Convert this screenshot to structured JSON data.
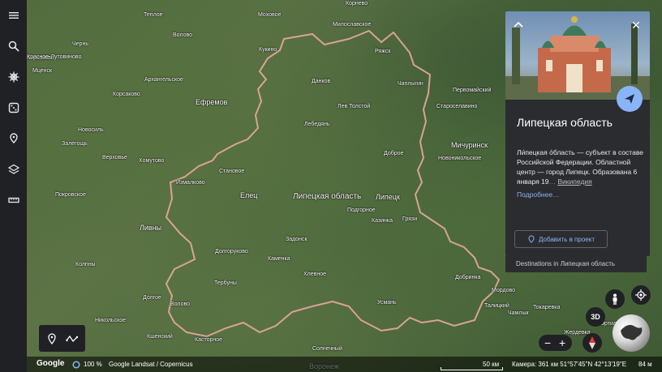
{
  "region_name": "Липецкая область",
  "map_labels": [
    {
      "text": "Корнево",
      "cls": ""
    },
    {
      "text": "Корсакова",
      "cls": ""
    },
    {
      "text": "Теплое",
      "cls": ""
    },
    {
      "text": "Моховое",
      "cls": ""
    },
    {
      "text": "Волово",
      "cls": ""
    },
    {
      "text": "Милославское",
      "cls": ""
    },
    {
      "text": "Чернь",
      "cls": ""
    },
    {
      "text": "Кукино",
      "cls": ""
    },
    {
      "text": "Ряжск",
      "cls": ""
    },
    {
      "text": "Красное-Лутовиново",
      "cls": ""
    },
    {
      "text": "Мценск",
      "cls": ""
    },
    {
      "text": "Архангельское",
      "cls": ""
    },
    {
      "text": "Данков",
      "cls": ""
    },
    {
      "text": "Чаплыгин",
      "cls": ""
    },
    {
      "text": "Первомайский",
      "cls": ""
    },
    {
      "text": "Корсаково",
      "cls": ""
    },
    {
      "text": "Ефремов",
      "cls": "big"
    },
    {
      "text": "Лев Толстой",
      "cls": ""
    },
    {
      "text": "Староселавино",
      "cls": ""
    },
    {
      "text": "Лебедянь",
      "cls": ""
    },
    {
      "text": "Мичуринск",
      "cls": "big"
    },
    {
      "text": "Новосиль",
      "cls": ""
    },
    {
      "text": "Залегощь",
      "cls": ""
    },
    {
      "text": "Доброе",
      "cls": ""
    },
    {
      "text": "Новоникольское",
      "cls": ""
    },
    {
      "text": "Верховье",
      "cls": ""
    },
    {
      "text": "Хомутово",
      "cls": ""
    },
    {
      "text": "Становое",
      "cls": ""
    },
    {
      "text": "Измалково",
      "cls": ""
    },
    {
      "text": "Елец",
      "cls": "big"
    },
    {
      "text": "Липецкая область",
      "cls": "region"
    },
    {
      "text": "Липецк",
      "cls": "big"
    },
    {
      "text": "Покровское",
      "cls": ""
    },
    {
      "text": "Подгорное",
      "cls": ""
    },
    {
      "text": "Казинка",
      "cls": ""
    },
    {
      "text": "Грязи",
      "cls": ""
    },
    {
      "text": "Ливны",
      "cls": "big"
    },
    {
      "text": "Задонск",
      "cls": ""
    },
    {
      "text": "Долгоруково",
      "cls": ""
    },
    {
      "text": "Каменка",
      "cls": ""
    },
    {
      "text": "Колпны",
      "cls": ""
    },
    {
      "text": "Хлевное",
      "cls": ""
    },
    {
      "text": "Добринка",
      "cls": ""
    },
    {
      "text": "Тербуны",
      "cls": ""
    },
    {
      "text": "Мордово",
      "cls": ""
    },
    {
      "text": "Долгое",
      "cls": ""
    },
    {
      "text": "Усмань",
      "cls": ""
    },
    {
      "text": "Талицкий",
      "cls": ""
    },
    {
      "text": "Чамлык",
      "cls": ""
    },
    {
      "text": "Токаревка",
      "cls": ""
    },
    {
      "text": "Волово",
      "cls": ""
    },
    {
      "text": "Никольское",
      "cls": ""
    },
    {
      "text": "Кшенский",
      "cls": ""
    },
    {
      "text": "Касторное",
      "cls": ""
    },
    {
      "text": "Солнечный",
      "cls": ""
    },
    {
      "text": "Жердевка",
      "cls": ""
    },
    {
      "text": "Эртиль",
      "cls": ""
    },
    {
      "text": "Воронеж",
      "cls": "big"
    }
  ],
  "panel": {
    "title": "Липецкая область",
    "description": "Ли́пецкая о́бласть — субъект в составе Российской Федерации. Областной центр — город Липецк. Образована 6 января 19",
    "wiki_link": "Википедия",
    "more_link": "Подробнее…",
    "add_button": "Добавить в проект",
    "destinations": "Destinations in Липецкая область"
  },
  "bottom_bar": {
    "logo": "Google",
    "loading": "100 %",
    "attribution": "Google   Landsat / Copernicus",
    "scale": "50 км",
    "camera": "Камера: 361 км   51°57'45\"N 42°13'19\"E",
    "elevation": "84 м"
  },
  "controls": {
    "view3d": "3D",
    "compass": "N"
  },
  "icons": {
    "menu": "menu-icon",
    "search": "search-icon",
    "voyager": "ship-wheel-icon",
    "random": "dice-icon",
    "projects": "pin-map-icon",
    "layers": "layers-icon",
    "measure": "ruler-icon"
  }
}
